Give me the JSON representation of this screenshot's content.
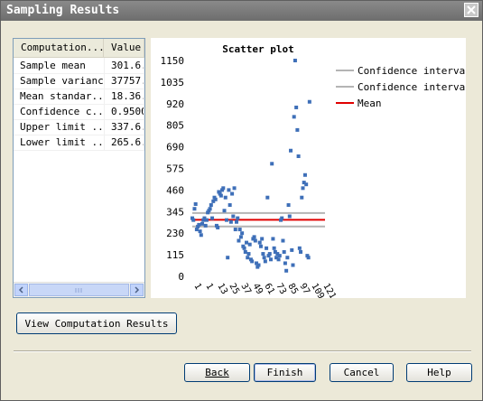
{
  "window": {
    "title": "Sampling Results"
  },
  "table": {
    "columns": [
      "Computation...",
      "Value"
    ],
    "rows": [
      [
        "Sample mean",
        "301.6."
      ],
      [
        "Sample variance",
        "37757."
      ],
      [
        "Mean standar...",
        "18.36."
      ],
      [
        "Confidence c...",
        "0.9500("
      ],
      [
        "Upper limit ...",
        "337.6."
      ],
      [
        "Lower limit ...",
        "265.6."
      ]
    ]
  },
  "chart_data": {
    "type": "scatter",
    "title": "Scatter plot",
    "ylim": [
      0,
      1150
    ],
    "yticks": [
      "0",
      "115",
      "230",
      "345",
      "460",
      "575",
      "690",
      "805",
      "920",
      "1035",
      "1150"
    ],
    "xticks": [
      "1",
      "1",
      "13",
      "25",
      "37",
      "49",
      "61",
      "73",
      "85",
      "97",
      "109",
      "121"
    ],
    "legend": [
      {
        "name": "Confidence interval",
        "color": "#b4b4b4"
      },
      {
        "name": "Confidence interval",
        "color": "#b4b4b4"
      },
      {
        "name": "Mean",
        "color": "#e00000"
      }
    ],
    "lines": {
      "upper": 337.6,
      "lower": 265.6,
      "mean": 301.6
    },
    "xlim": [
      1,
      121
    ],
    "point_color": "#3e6fb8",
    "points": [
      [
        1,
        310
      ],
      [
        2,
        300
      ],
      [
        3,
        360
      ],
      [
        4,
        385
      ],
      [
        5,
        250
      ],
      [
        6,
        265
      ],
      [
        7,
        275
      ],
      [
        8,
        240
      ],
      [
        9,
        220
      ],
      [
        10,
        280
      ],
      [
        11,
        300
      ],
      [
        12,
        310
      ],
      [
        13,
        270
      ],
      [
        14,
        300
      ],
      [
        15,
        340
      ],
      [
        16,
        350
      ],
      [
        17,
        360
      ],
      [
        18,
        380
      ],
      [
        19,
        310
      ],
      [
        20,
        400
      ],
      [
        21,
        420
      ],
      [
        22,
        410
      ],
      [
        23,
        270
      ],
      [
        24,
        260
      ],
      [
        25,
        450
      ],
      [
        26,
        440
      ],
      [
        27,
        430
      ],
      [
        28,
        460
      ],
      [
        29,
        470
      ],
      [
        30,
        350
      ],
      [
        31,
        420
      ],
      [
        32,
        300
      ],
      [
        33,
        100
      ],
      [
        34,
        460
      ],
      [
        35,
        380
      ],
      [
        36,
        290
      ],
      [
        37,
        440
      ],
      [
        38,
        320
      ],
      [
        39,
        470
      ],
      [
        40,
        250
      ],
      [
        41,
        290
      ],
      [
        42,
        310
      ],
      [
        43,
        190
      ],
      [
        44,
        250
      ],
      [
        45,
        210
      ],
      [
        46,
        230
      ],
      [
        47,
        160
      ],
      [
        48,
        150
      ],
      [
        49,
        130
      ],
      [
        50,
        180
      ],
      [
        51,
        100
      ],
      [
        52,
        120
      ],
      [
        53,
        170
      ],
      [
        54,
        90
      ],
      [
        55,
        80
      ],
      [
        56,
        200
      ],
      [
        57,
        210
      ],
      [
        58,
        190
      ],
      [
        59,
        70
      ],
      [
        60,
        50
      ],
      [
        61,
        60
      ],
      [
        62,
        180
      ],
      [
        63,
        160
      ],
      [
        64,
        200
      ],
      [
        65,
        120
      ],
      [
        66,
        100
      ],
      [
        67,
        80
      ],
      [
        68,
        150
      ],
      [
        69,
        420
      ],
      [
        70,
        110
      ],
      [
        71,
        120
      ],
      [
        72,
        90
      ],
      [
        73,
        600
      ],
      [
        74,
        200
      ],
      [
        75,
        150
      ],
      [
        76,
        130
      ],
      [
        77,
        100
      ],
      [
        78,
        120
      ],
      [
        79,
        90
      ],
      [
        80,
        110
      ],
      [
        81,
        300
      ],
      [
        82,
        310
      ],
      [
        83,
        190
      ],
      [
        84,
        130
      ],
      [
        85,
        70
      ],
      [
        86,
        30
      ],
      [
        87,
        100
      ],
      [
        88,
        380
      ],
      [
        89,
        320
      ],
      [
        90,
        670
      ],
      [
        91,
        140
      ],
      [
        92,
        60
      ],
      [
        93,
        850
      ],
      [
        94,
        1150
      ],
      [
        95,
        900
      ],
      [
        96,
        780
      ],
      [
        97,
        640
      ],
      [
        98,
        150
      ],
      [
        99,
        130
      ],
      [
        100,
        420
      ],
      [
        101,
        470
      ],
      [
        102,
        500
      ],
      [
        103,
        540
      ],
      [
        104,
        490
      ],
      [
        105,
        110
      ],
      [
        106,
        100
      ],
      [
        107,
        930
      ]
    ]
  },
  "buttons": {
    "view": "View Computation Results",
    "back": "Back",
    "finish": "Finish",
    "cancel": "Cancel",
    "help": "Help"
  }
}
